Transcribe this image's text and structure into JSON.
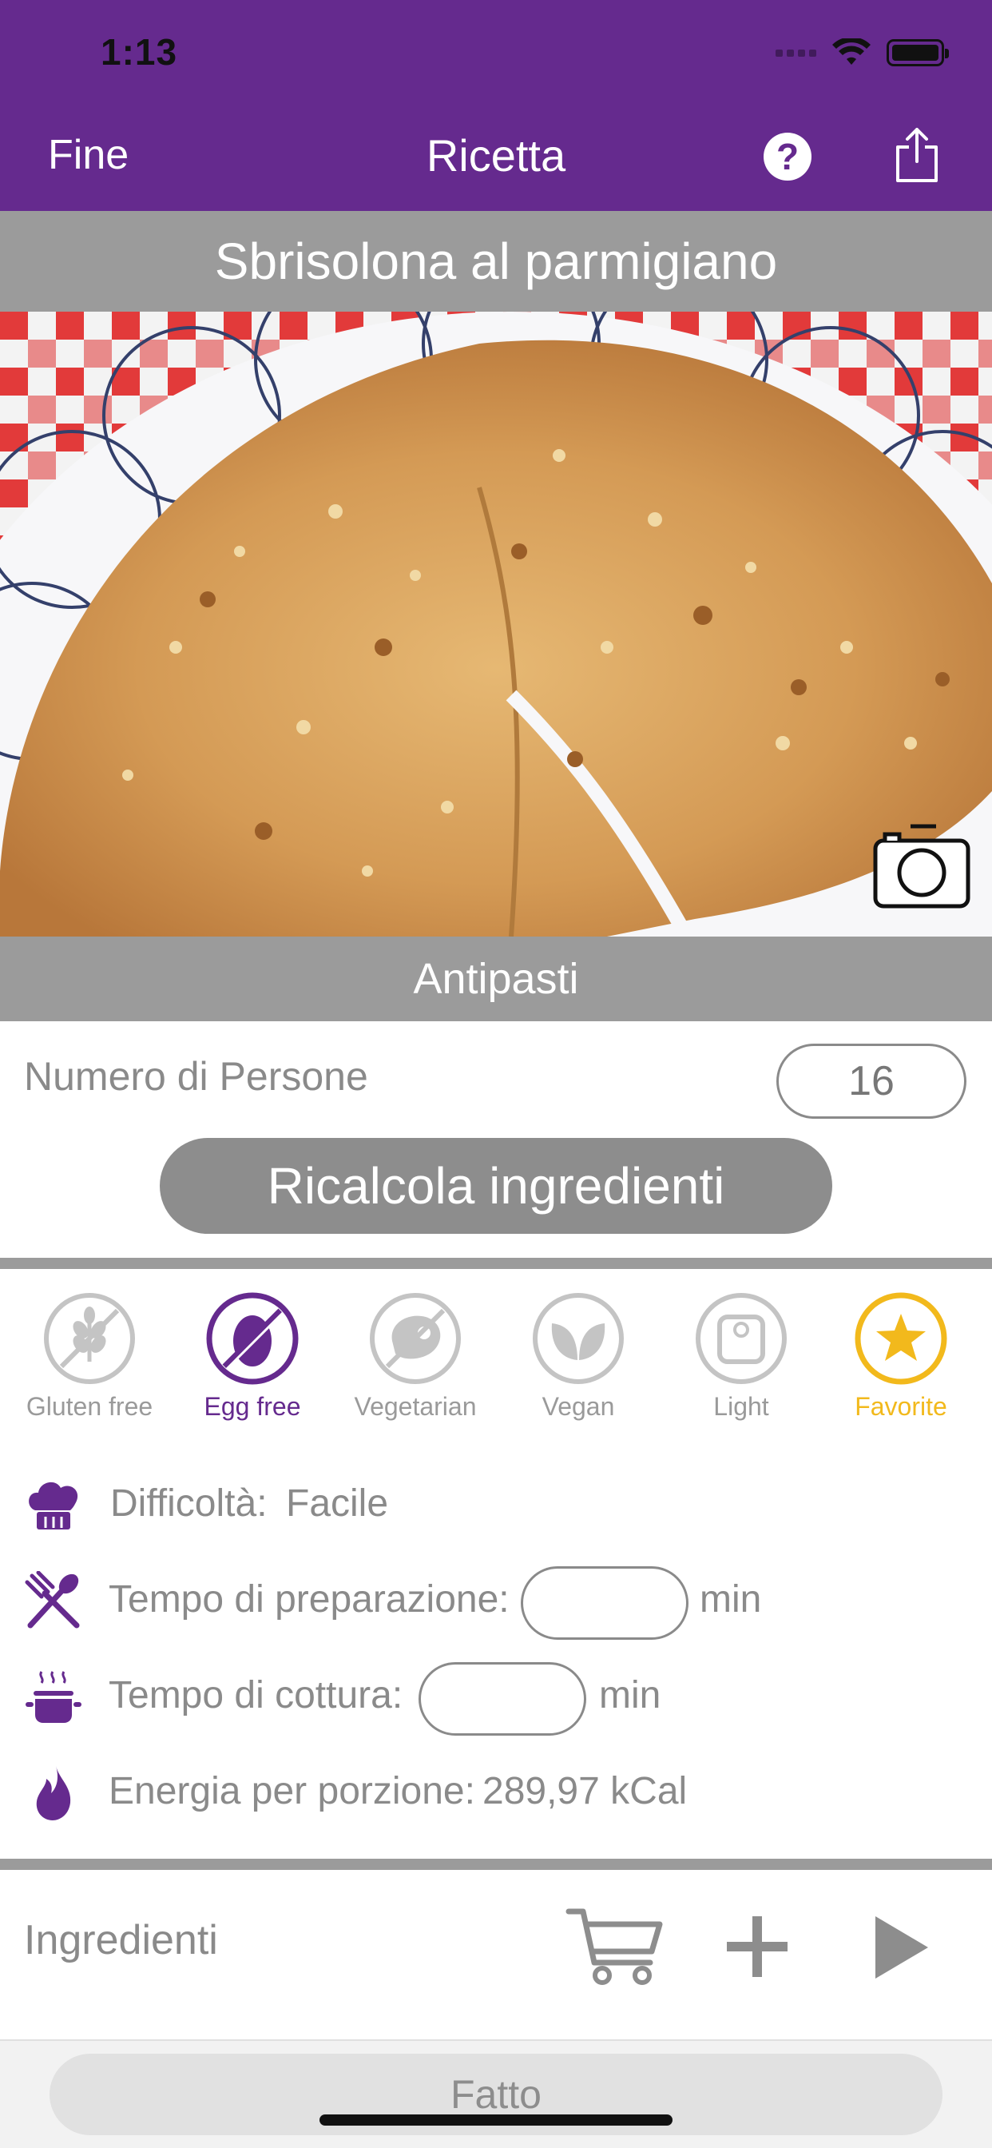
{
  "status": {
    "time": "1:13"
  },
  "nav": {
    "left": "Fine",
    "title": "Ricetta"
  },
  "recipe": {
    "title": "Sbrisolona al parmigiano",
    "category": "Antipasti",
    "persons_label": "Numero di Persone",
    "persons_value": "16",
    "recalc_label": "Ricalcola ingredienti"
  },
  "filters": [
    {
      "label": "Gluten free",
      "icon": "wheat-crossed-icon",
      "active": false
    },
    {
      "label": "Egg free",
      "icon": "egg-crossed-icon",
      "active": true
    },
    {
      "label": "Vegetarian",
      "icon": "meat-crossed-icon",
      "active": false
    },
    {
      "label": "Vegan",
      "icon": "leaf-icon",
      "active": false
    },
    {
      "label": "Light",
      "icon": "scale-icon",
      "active": false
    },
    {
      "label": "Favorite",
      "icon": "star-icon",
      "active": true
    }
  ],
  "colors": {
    "brand": "#652a8e",
    "gray": "#9b9b9b",
    "favorite": "#f2b91c"
  },
  "details": {
    "difficulty_label": "Difficoltà:",
    "difficulty_value": "Facile",
    "prep_label": "Tempo di preparazione:",
    "prep_value": "",
    "prep_unit": "min",
    "cook_label": "Tempo di cottura:",
    "cook_value": "",
    "cook_unit": "min",
    "energy_label": "Energia per porzione:",
    "energy_value": "289,97 kCal"
  },
  "ingredients": {
    "label": "Ingredienti"
  },
  "footer": {
    "done_label": "Fatto"
  }
}
